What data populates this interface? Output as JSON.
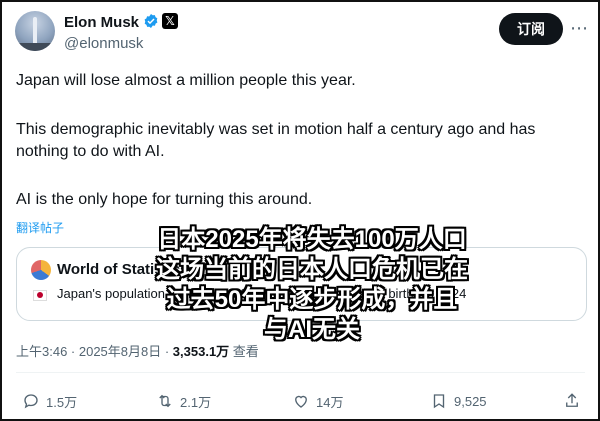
{
  "author": {
    "name": "Elon Musk",
    "handle": "@elonmusk"
  },
  "header": {
    "subscribe_label": "订阅",
    "more_glyph": "⋯"
  },
  "tweet": {
    "paragraphs": [
      "Japan will lose almost a million people this year.",
      "This demographic inevitably was set in motion half a century ago and has nothing to do with AI.",
      "AI is the only hope for turning this around."
    ],
    "translate_label": "翻译帖子"
  },
  "quoted_card": {
    "source": "World of Statistics",
    "line2": "Japan's population falling with 900,000 more deaths than births in 2024"
  },
  "meta": {
    "time": "上午3:46 · 2025年8月8日 · ",
    "views_count": "3,353.1万",
    "views_label": " 查看"
  },
  "actions": {
    "replies": "1.5万",
    "reposts": "2.1万",
    "likes": "14万",
    "bookmarks": "9,525"
  },
  "overlay_caption": [
    "日本2025年将失去100万人口",
    "这场当前的日本人口危机已在",
    "过去50年中逐步形成，并且",
    "与AI无关"
  ],
  "colors": {
    "accent": "#1d9bf0",
    "text": "#0f1419",
    "muted": "#536471"
  }
}
